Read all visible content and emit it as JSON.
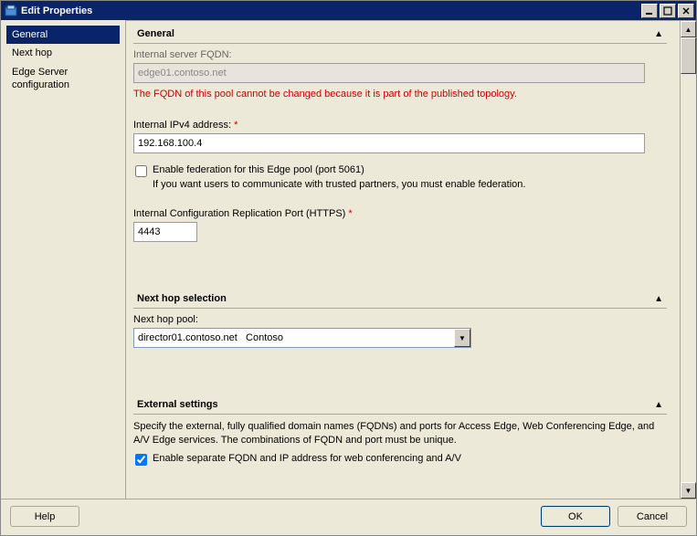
{
  "window": {
    "title": "Edit Properties"
  },
  "nav": {
    "items": [
      "General",
      "Next hop",
      "Edge Server configuration"
    ],
    "selected": 0
  },
  "general": {
    "header": "General",
    "fqdn_label": "Internal server FQDN:",
    "fqdn_value": "edge01.contoso.net",
    "fqdn_warning": "The FQDN of this pool cannot be changed because it is part of the published topology.",
    "ipv4_label": "Internal IPv4 address:",
    "ipv4_value": "192.168.100.4",
    "federation_label": "Enable federation for this Edge pool (port 5061)",
    "federation_checked": false,
    "federation_hint": "If you want users to communicate with trusted partners, you must enable federation.",
    "repl_port_label": "Internal Configuration Replication Port (HTTPS)",
    "repl_port_value": "4443"
  },
  "nexthop": {
    "header": "Next hop selection",
    "pool_label": "Next hop pool:",
    "pool_value": "director01.contoso.net   Contoso"
  },
  "external": {
    "header": "External settings",
    "desc": "Specify the external, fully qualified domain names (FQDNs) and ports for Access Edge, Web Conferencing Edge, and A/V Edge services. The combinations of FQDN and port must be unique.",
    "separate_label": "Enable separate FQDN and IP address for web conferencing and A/V",
    "separate_checked": true
  },
  "footer": {
    "help": "Help",
    "ok": "OK",
    "cancel": "Cancel"
  }
}
